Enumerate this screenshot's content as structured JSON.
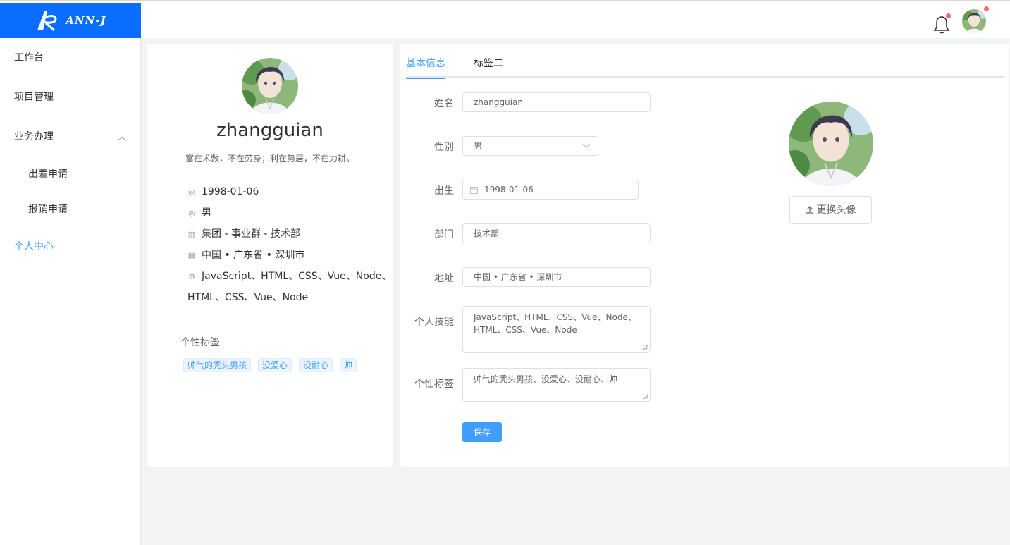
{
  "app": {
    "logo_text": "ANN-J"
  },
  "sidebar": {
    "items": [
      {
        "label": "工作台"
      },
      {
        "label": "项目管理"
      },
      {
        "label": "业务办理",
        "expanded": true
      },
      {
        "label": "出差申请"
      },
      {
        "label": "报销申请"
      },
      {
        "label": "个人中心",
        "active": true
      }
    ]
  },
  "profile": {
    "username": "zhangguian",
    "motto": "富在术数，不在劳身；利在势居，不在力耕。",
    "birthday": "1998-01-06",
    "gender": "男",
    "department": "集团 - 事业群 - 技术部",
    "address": "中国 • 广东省 • 深圳市",
    "skills_line1": "JavaScript、HTML、CSS、Vue、Node、",
    "skills_line2": "HTML、CSS、Vue、Node",
    "tags_title": "个性标签",
    "tags": [
      "帅气的秃头男孩",
      "没爱心",
      "没耐心",
      "帅"
    ]
  },
  "tabs": [
    {
      "label": "基本信息",
      "active": true
    },
    {
      "label": "标签二"
    }
  ],
  "form": {
    "name_label": "姓名",
    "name_value": "zhangguian",
    "gender_label": "性别",
    "gender_value": "男",
    "birth_label": "出生",
    "birth_value": "1998-01-06",
    "dept_label": "部门",
    "dept_value": "技术部",
    "addr_label": "地址",
    "addr_value": "中国 • 广东省 • 深圳市",
    "skills_label": "个人技能",
    "skills_line1": "JavaScript、HTML、CSS、Vue、Node、",
    "skills_line2": "HTML、CSS、Vue、Node",
    "tags_label": "个性标签",
    "tags_value": "帅气的秃头男孩、没爱心、没耐心、帅",
    "save_label": "保存"
  },
  "upload": {
    "label": "更换头像"
  },
  "colors": {
    "brand": "#0a6dff",
    "primary": "#409eff",
    "badge": "#f56c6c"
  }
}
